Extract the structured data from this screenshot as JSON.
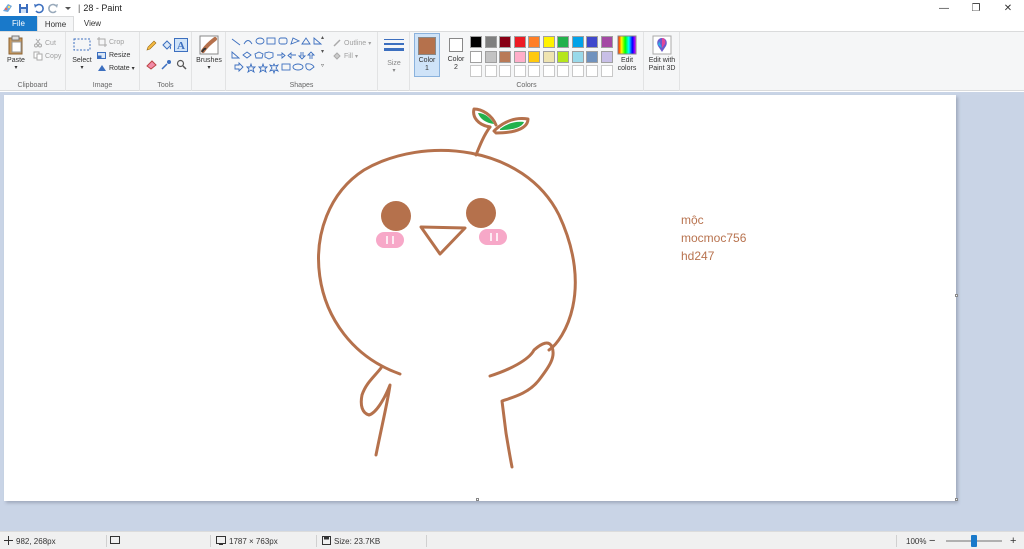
{
  "titlebar": {
    "separator": "|",
    "title": "28 - Paint",
    "minimize": "—",
    "maximize": "❐",
    "close": "✕"
  },
  "tabs": {
    "file": "File",
    "home": "Home",
    "view": "View"
  },
  "ribbon": {
    "clipboard": {
      "label": "Clipboard",
      "paste": "Paste",
      "cut": "Cut",
      "copy": "Copy"
    },
    "image": {
      "label": "Image",
      "select": "Select",
      "crop": "Crop",
      "resize": "Resize",
      "rotate": "Rotate"
    },
    "tools": {
      "label": "Tools"
    },
    "brushes": {
      "label": "Brushes"
    },
    "shapes": {
      "label": "Shapes",
      "outline": "Outline",
      "fill": "Fill"
    },
    "size": {
      "label": "Size"
    },
    "colors": {
      "label": "Colors",
      "color1": "Color\n1",
      "color1_value": "#b5714c",
      "color2": "Color\n2",
      "color2_value": "#ffffff",
      "edit_colors": "Edit\ncolors",
      "palette_row1": [
        "#000000",
        "#7f7f7f",
        "#880015",
        "#ed1c24",
        "#ff7f27",
        "#fff200",
        "#22b14c",
        "#00a2e8",
        "#3f48cc",
        "#a349a4"
      ],
      "palette_row2": [
        "#ffffff",
        "#c3c3c3",
        "#b97a57",
        "#ffaec9",
        "#ffc90e",
        "#efe4b0",
        "#b5e61d",
        "#99d9ea",
        "#7092be",
        "#c8bfe7"
      ]
    },
    "paint3d": {
      "label": "Edit with\nPaint 3D"
    }
  },
  "canvas": {
    "text_lines": [
      "mộc",
      "mocmoc756",
      "hd247"
    ],
    "text_color": "#b8734f",
    "stroke_color": "#b5714c",
    "eye_color": "#b5714c",
    "blush_color": "#f7a8c8",
    "leaf_color": "#22b14c"
  },
  "statusbar": {
    "cursor_pos": "982, 268px",
    "dimensions": "1787 × 763px",
    "size": "Size: 23.7KB",
    "zoom": "100%",
    "zoom_out": "−",
    "zoom_in": "+"
  }
}
